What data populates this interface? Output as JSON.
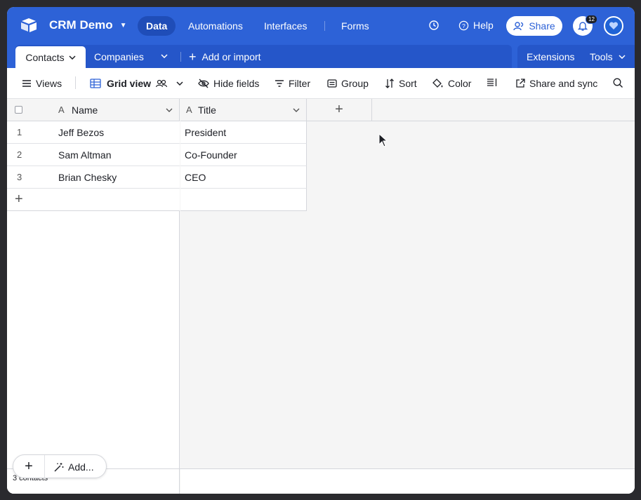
{
  "app": {
    "title": "CRM Demo",
    "nav": [
      "Data",
      "Automations",
      "Interfaces",
      "Forms"
    ],
    "help_label": "Help",
    "share_label": "Share",
    "notification_count": "12",
    "brand_color": "#2d62d7"
  },
  "tabs": {
    "active": "Contacts",
    "other": "Companies",
    "add_label": "Add or import",
    "extensions_label": "Extensions",
    "tools_label": "Tools"
  },
  "toolbar": {
    "views_label": "Views",
    "view_name": "Grid view",
    "hide_fields": "Hide fields",
    "filter": "Filter",
    "group": "Group",
    "sort": "Sort",
    "color": "Color",
    "share_sync": "Share and sync"
  },
  "grid": {
    "columns": [
      "Name",
      "Title"
    ],
    "rows": [
      {
        "num": "1",
        "name": "Jeff Bezos",
        "title": "President"
      },
      {
        "num": "2",
        "name": "Sam Altman",
        "title": "Co-Founder"
      },
      {
        "num": "3",
        "name": "Brian Chesky",
        "title": "CEO"
      }
    ],
    "add_label": "Add...",
    "summary": "3 contacts"
  }
}
